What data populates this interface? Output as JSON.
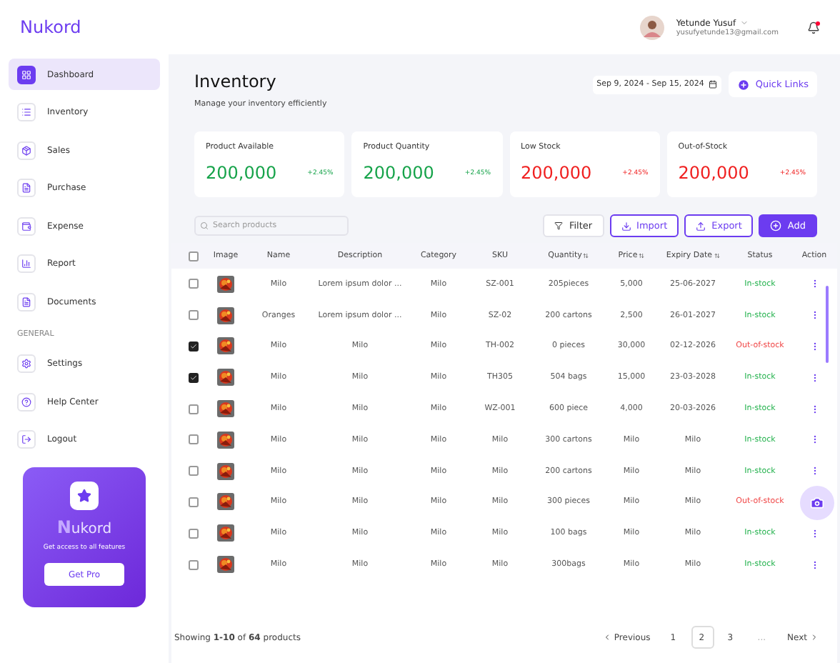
{
  "brand": "Nukord",
  "user": {
    "name": "Yetunde Yusuf",
    "email": "yusufyetunde13@gmail.com"
  },
  "sidebar": {
    "items": [
      {
        "label": "Dashboard",
        "selected": true
      },
      {
        "label": "Inventory",
        "selected": false
      },
      {
        "label": "Sales",
        "selected": false
      },
      {
        "label": "Purchase",
        "selected": false
      },
      {
        "label": "Expense",
        "selected": false
      },
      {
        "label": "Report",
        "selected": false
      },
      {
        "label": "Documents",
        "selected": false
      }
    ],
    "section": "GENERAL",
    "general": [
      {
        "label": "Settings",
        "selected": false
      },
      {
        "label": "Help Center",
        "selected": false
      },
      {
        "label": "Logout",
        "selected": false
      }
    ],
    "promo": {
      "brand": "Nukord",
      "text": "Get access to all features",
      "button": "Get Pro"
    }
  },
  "page": {
    "title": "Inventory",
    "subtitle": "Manage your inventory efficiently",
    "date_range": "Sep 9, 2024 - Sep 15, 2024",
    "quick_links": "Quick Links"
  },
  "stats": [
    {
      "label": "Product Available",
      "value": "200,000",
      "change": "+2.45%",
      "color": "#16a34a"
    },
    {
      "label": "Product Quantity",
      "value": "200,000",
      "change": "+2.45%",
      "color": "#16a34a"
    },
    {
      "label": "Low Stock",
      "value": "200,000",
      "change": "+2.45%",
      "color": "#f02020"
    },
    {
      "label": "Out-of-Stock",
      "value": "200,000",
      "change": "+2.45%",
      "color": "#f02020"
    }
  ],
  "toolbar": {
    "search_placeholder": "Search products",
    "filter": "Filter",
    "import": "Import",
    "export": "Export",
    "add": "Add"
  },
  "table": {
    "select_all_checked": false,
    "columns": [
      {
        "label": "Image",
        "sortable": false
      },
      {
        "label": "Name",
        "sortable": false
      },
      {
        "label": "Description",
        "sortable": false
      },
      {
        "label": "Category",
        "sortable": false
      },
      {
        "label": "SKU",
        "sortable": false
      },
      {
        "label": "Quantity",
        "sortable": true
      },
      {
        "label": "Price",
        "sortable": true
      },
      {
        "label": "Expiry Date",
        "sortable": true
      },
      {
        "label": "Status",
        "sortable": false
      },
      {
        "label": "Action",
        "sortable": false
      }
    ],
    "rows": [
      {
        "selected": false,
        "name": "Milo",
        "description": "Lorem ipsum dolor ...",
        "category": "Milo",
        "sku": "SZ-001",
        "quantity": "205pieces",
        "price": "5,000",
        "expiry": "25-06-2027",
        "status": "In-stock",
        "kind": "in"
      },
      {
        "selected": false,
        "name": "Oranges",
        "description": "Lorem ipsum dolor ...",
        "category": "Milo",
        "sku": "SZ-02",
        "quantity": "200 cartons",
        "price": "2,500",
        "expiry": "26-01-2027",
        "status": "In-stock",
        "kind": "in"
      },
      {
        "selected": true,
        "name": "Milo",
        "description": "Milo",
        "category": "Milo",
        "sku": "TH-002",
        "quantity": "0 pieces",
        "price": "30,000",
        "expiry": "02-12-2026",
        "status": "Out-of-stock",
        "kind": "out"
      },
      {
        "selected": true,
        "name": "Milo",
        "description": "Milo",
        "category": "Milo",
        "sku": "TH305",
        "quantity": "504 bags",
        "price": "15,000",
        "expiry": "23-03-2028",
        "status": "In-stock",
        "kind": "in"
      },
      {
        "selected": false,
        "name": "Milo",
        "description": "Milo",
        "category": "Milo",
        "sku": "WZ-001",
        "quantity": "600 piece",
        "price": "4,000",
        "expiry": "20-03-2026",
        "status": "In-stock",
        "kind": "in"
      },
      {
        "selected": false,
        "name": "Milo",
        "description": "Milo",
        "category": "Milo",
        "sku": "Milo",
        "quantity": "300 cartons",
        "price": "Milo",
        "expiry": "Milo",
        "status": "In-stock",
        "kind": "in"
      },
      {
        "selected": false,
        "name": "Milo",
        "description": "Milo",
        "category": "Milo",
        "sku": "Milo",
        "quantity": "200 cartons",
        "price": "Milo",
        "expiry": "Milo",
        "status": "In-stock",
        "kind": "in"
      },
      {
        "selected": false,
        "name": "Milo",
        "description": "Milo",
        "category": "Milo",
        "sku": "Milo",
        "quantity": "300 pieces",
        "price": "Milo",
        "expiry": "Milo",
        "status": "Out-of-stock",
        "kind": "out",
        "menu_covered": true
      },
      {
        "selected": false,
        "name": "Milo",
        "description": "Milo",
        "category": "Milo",
        "sku": "Milo",
        "quantity": "100 bags",
        "price": "Milo",
        "expiry": "Milo",
        "status": "In-stock",
        "kind": "in"
      },
      {
        "selected": false,
        "name": "Milo",
        "description": "Milo",
        "category": "Milo",
        "sku": "Milo",
        "quantity": "300bags",
        "price": "Milo",
        "expiry": "Milo",
        "status": "In-stock",
        "kind": "in"
      }
    ]
  },
  "pagination": {
    "summary": "Showing **1-10** of **64** products",
    "previous": "Previous",
    "pages": [
      {
        "label": "1",
        "selected": false
      },
      {
        "label": "2",
        "selected": true
      },
      {
        "label": "3",
        "selected": false
      }
    ],
    "ellipsis": "...",
    "next": "Next"
  }
}
